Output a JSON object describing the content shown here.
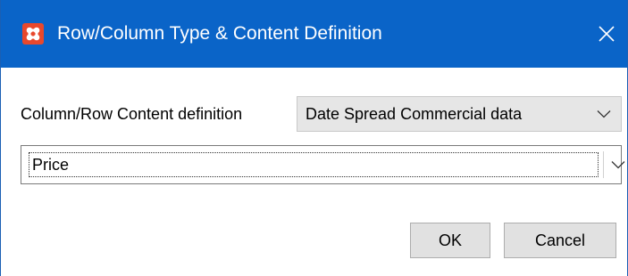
{
  "window": {
    "title": "Row/Column Type & Content Definition",
    "app_icon": "app-icon",
    "close_icon": "close-icon",
    "titlebar_color": "#0a64c8",
    "app_icon_color": "#e8482c"
  },
  "form": {
    "content_definition_label": "Column/Row Content definition",
    "content_definition_value": "Date Spread Commercial data",
    "content_type_value": "Price"
  },
  "buttons": {
    "ok_label": "OK",
    "cancel_label": "Cancel"
  }
}
